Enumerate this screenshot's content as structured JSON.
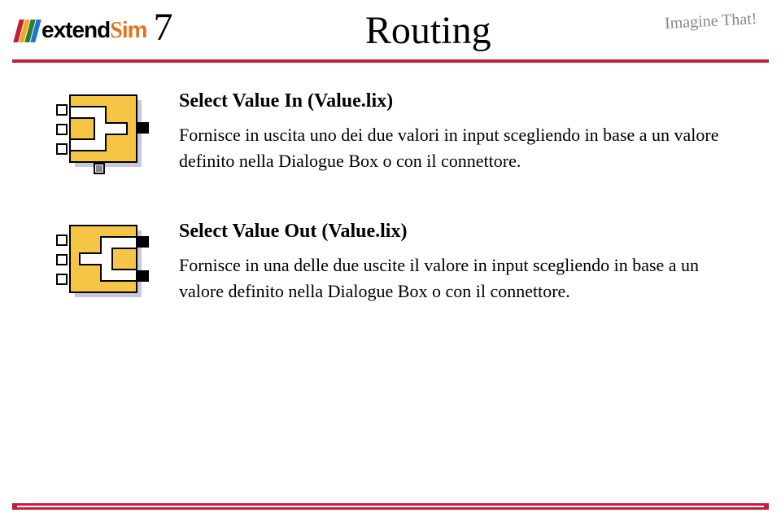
{
  "header": {
    "logo_text_1": "extend",
    "logo_text_2": "S",
    "logo_text_3": "im",
    "version": "7",
    "title": "Routing",
    "tagline": "Imagine That!"
  },
  "blocks": [
    {
      "title": "Select Value In (Value.lix)",
      "description": "Fornisce in uscita uno dei due valori in input scegliendo in base a un valore definito nella Dialogue Box o con il connettore."
    },
    {
      "title": "Select Value Out (Value.lix)",
      "description": "Fornisce in una delle due uscite il valore in input scegliendo in base a un valore definito nella Dialogue Box o con il connettore."
    }
  ]
}
